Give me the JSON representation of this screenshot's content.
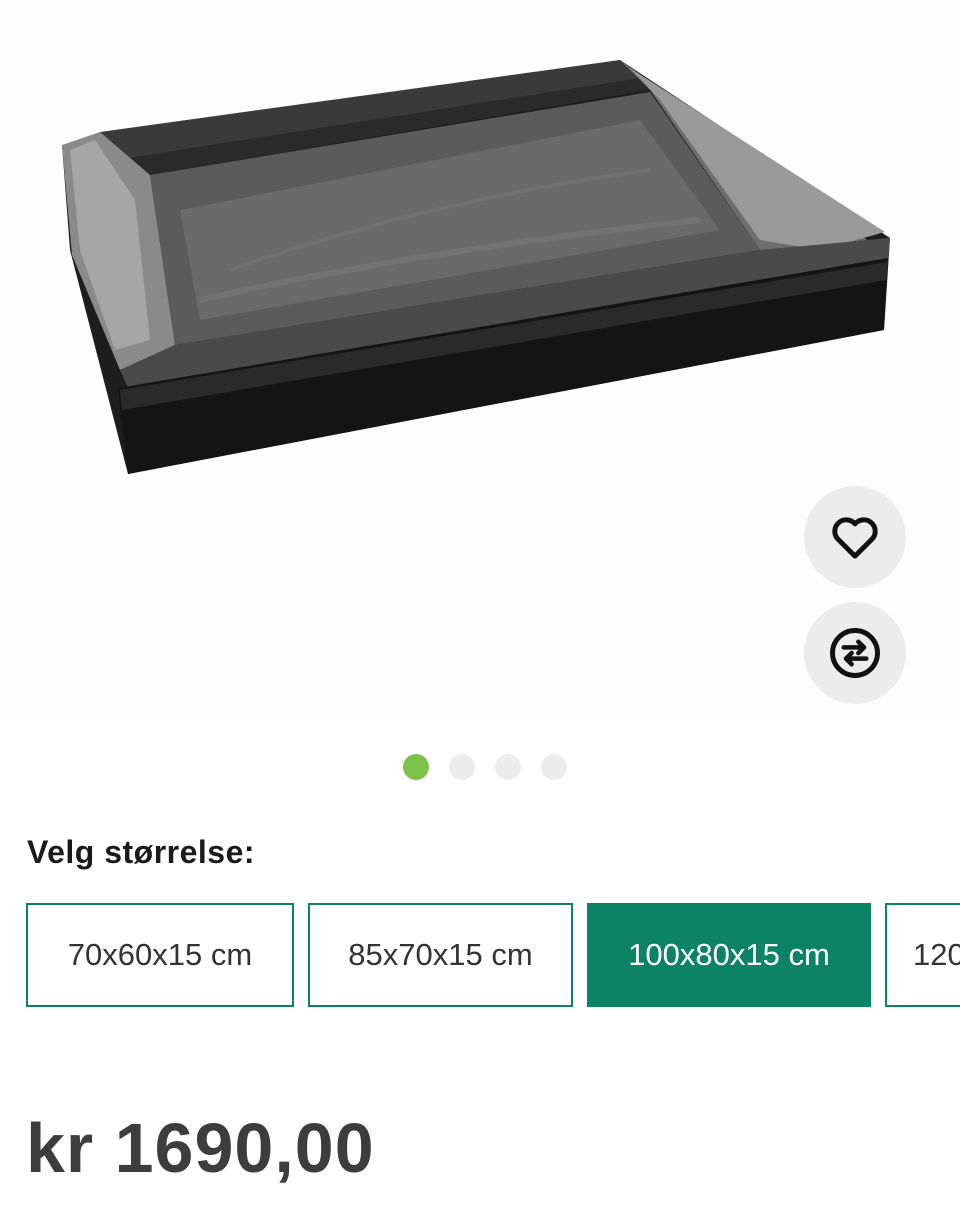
{
  "gallery": {
    "image_alt": "Black dog bed",
    "dots": [
      {
        "active": true
      },
      {
        "active": false
      },
      {
        "active": false
      },
      {
        "active": false
      }
    ],
    "favorite_icon": "heart-icon",
    "compare_icon": "compare-arrows-icon"
  },
  "size_selector": {
    "label": "Velg størrelse:",
    "options": [
      {
        "label": "70x60x15 cm",
        "selected": false
      },
      {
        "label": "85x70x15 cm",
        "selected": false
      },
      {
        "label": "100x80x15 cm",
        "selected": true
      },
      {
        "label": "120",
        "selected": false
      }
    ]
  },
  "price": "kr 1690,00",
  "colors": {
    "accent": "#0d8365",
    "dot_active": "#7dc24a"
  }
}
